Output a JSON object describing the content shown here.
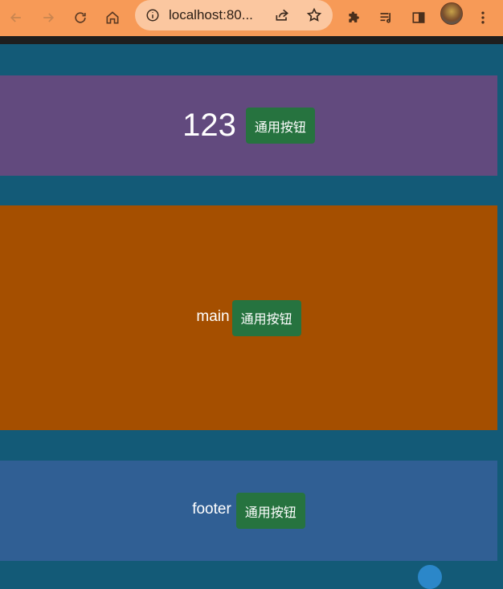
{
  "browser": {
    "url": "localhost:80...",
    "icons": {
      "back": "back-arrow-icon",
      "forward": "forward-arrow-icon",
      "reload": "reload-icon",
      "home": "home-icon",
      "info": "info-icon",
      "share": "share-icon",
      "bookmark": "star-icon",
      "extensions": "puzzle-icon",
      "media": "media-queue-icon",
      "sidepanel": "side-panel-icon",
      "menu": "kebab-menu-icon"
    },
    "colors": {
      "toolbar": "#f79a57",
      "omnibox": "#fbc7a0"
    }
  },
  "page": {
    "background": "#135a77",
    "header": {
      "label": "123",
      "button_label": "通用按钮",
      "background": "#624a7e"
    },
    "main": {
      "label": "main",
      "button_label": "通用按钮",
      "background": "#a54f00"
    },
    "footer": {
      "label": "footer",
      "button_label": "通用按钮",
      "background": "#305f94"
    },
    "button_color": "#26733f"
  }
}
